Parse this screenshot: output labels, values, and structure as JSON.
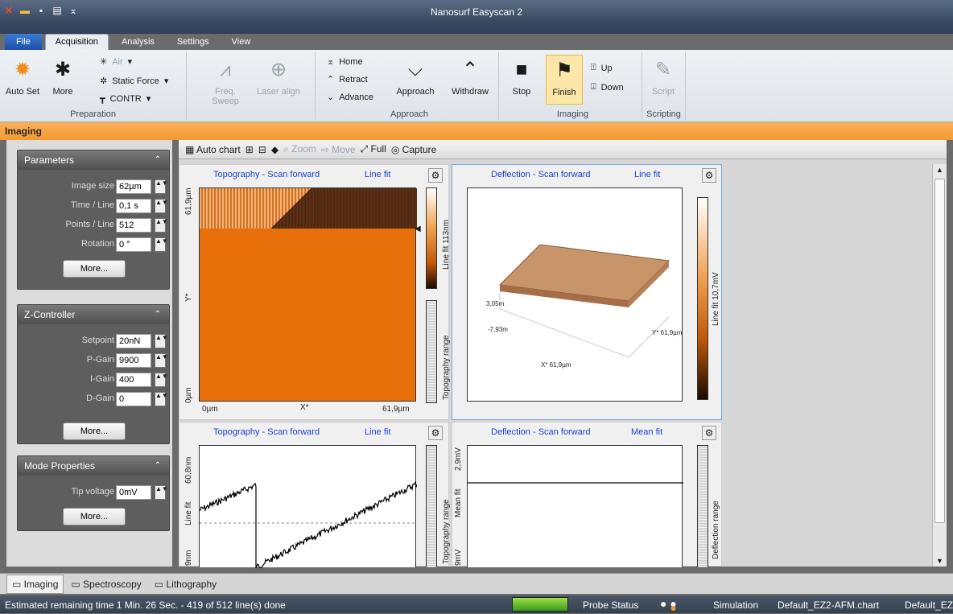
{
  "window": {
    "title": "Nanosurf Easyscan 2"
  },
  "ribbon_tabs": [
    "File",
    "Acquisition",
    "Analysis",
    "Settings",
    "View"
  ],
  "preparation": {
    "auto_set": "Auto Set",
    "more": "More",
    "air": "Air",
    "static_force": "Static Force",
    "contr": "CONTR",
    "freq_sweep": "Freq. Sweep",
    "laser_align": "Laser align",
    "label": "Preparation"
  },
  "approach": {
    "home": "Home",
    "retract": "Retract",
    "advance": "Advance",
    "approach": "Approach",
    "withdraw": "Withdraw",
    "label": "Approach"
  },
  "imaging_group": {
    "stop": "Stop",
    "finish": "Finish",
    "up": "Up",
    "down": "Down",
    "label": "Imaging"
  },
  "scripting": {
    "script": "Script",
    "label": "Scripting"
  },
  "imaging_header": "Imaging",
  "parameters": {
    "title": "Parameters",
    "rows": [
      {
        "label": "Image size",
        "value": "62µm"
      },
      {
        "label": "Time / Line",
        "value": "0,1 s"
      },
      {
        "label": "Points / Line",
        "value": "512"
      },
      {
        "label": "Rotation",
        "value": "0 °"
      }
    ],
    "more": "More..."
  },
  "z_controller": {
    "title": "Z-Controller",
    "rows": [
      {
        "label": "Setpoint",
        "value": "20nN"
      },
      {
        "label": "P-Gain",
        "value": "9900"
      },
      {
        "label": "I-Gain",
        "value": "400"
      },
      {
        "label": "D-Gain",
        "value": "0"
      }
    ],
    "more": "More..."
  },
  "mode_properties": {
    "title": "Mode Properties",
    "rows": [
      {
        "label": "Tip voltage",
        "value": "0mV"
      }
    ],
    "more": "More..."
  },
  "chart_toolbar": {
    "auto_chart": "Auto chart",
    "zoom": "Zoom",
    "move": "Move",
    "full": "Full",
    "capture": "Capture"
  },
  "charts": {
    "c1": {
      "title": "Topography - Scan forward",
      "fit": "Line fit",
      "y_top": "61,9µm",
      "y_mid": "Y*",
      "y_bottom": "0µm",
      "x_left": "0µm",
      "x_mid": "X*",
      "x_right": "61,9µm",
      "scale_label": "Line fit 113nm",
      "range_label": "Topography range"
    },
    "c2": {
      "title": "Deflection - Scan forward",
      "fit": "Line fit",
      "z_top": "3,05m",
      "z_bottom": "-7,93m",
      "x_axis": "X* 61,9µm",
      "y_axis": "Y* 61,9µm",
      "scale_label": "Line fit 10,7mV"
    },
    "c3": {
      "title": "Topography - Scan forward",
      "fit": "Line fit",
      "y_top": "60,8nm",
      "y_mid": "Line fit",
      "y_bottom": "9nm",
      "range_label": "Topography range"
    },
    "c4": {
      "title": "Deflection - Scan forward",
      "fit": "Mean fit",
      "y_top": "2,9mV",
      "y_mid": "Mean fit",
      "y_bottom": "9mV",
      "range_label": "Deflection range"
    }
  },
  "bottom_tabs": [
    "Imaging",
    "Spectroscopy",
    "Lithography"
  ],
  "status": {
    "text": "Estimated remaining time 1 Min. 26 Sec. - 419 of 512 line(s) done",
    "probe_status": "Probe Status",
    "simulation": "Simulation",
    "chart_file": "Default_EZ2-AFM.chart",
    "config": "Default_EZ"
  },
  "colors": {
    "accent_orange": "#f39a2e",
    "topo_orange": "#e8700a",
    "title_blue": "#1a3fd0"
  }
}
